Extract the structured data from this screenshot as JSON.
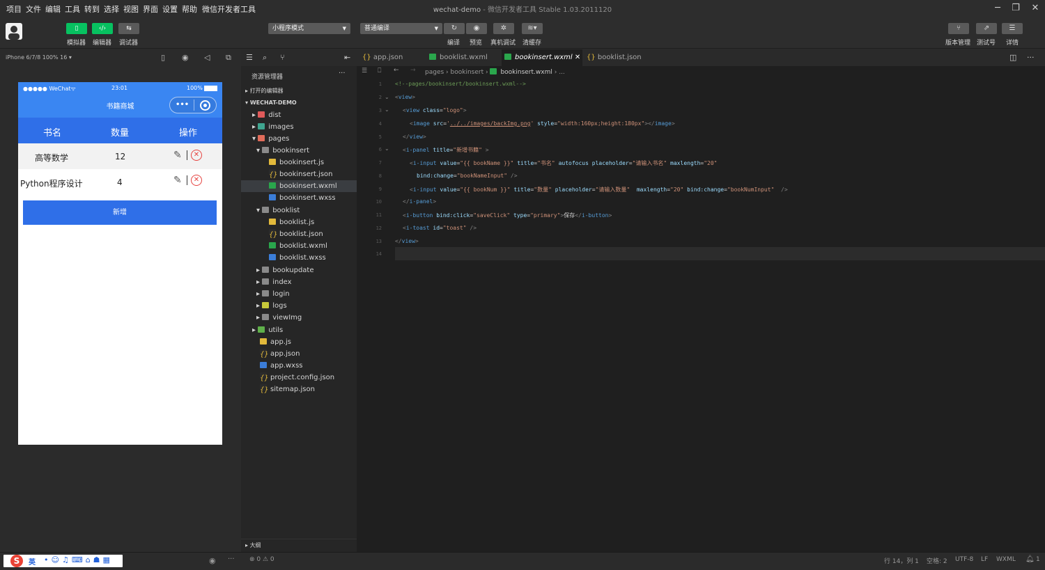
{
  "menu": {
    "items": [
      "项目",
      "文件",
      "编辑",
      "工具",
      "转到",
      "选择",
      "视图",
      "界面",
      "设置",
      "帮助",
      "微信开发者工具"
    ]
  },
  "window": {
    "title": "wechat-demo",
    "app_name": "微信开发者工具 Stable 1.03.2011120"
  },
  "toolbar": {
    "simulator_label": "模拟器",
    "editor_label": "编辑器",
    "debugger_label": "调试器",
    "mode_select": "小程序模式",
    "compile_select": "普通编译",
    "compile_label": "编译",
    "preview_label": "预览",
    "realdevice_label": "真机调试",
    "clearcache_label": "清缓存",
    "version_label": "版本管理",
    "testid_label": "测试号",
    "details_label": "详情",
    "accent": "#07c160"
  },
  "simulator": {
    "device": "iPhone 6/7/8 100% 16 ▾",
    "status_carrier": "●●●●● WeChat",
    "status_time": "23:01",
    "status_battery": "100%",
    "nav_title": "书籍商城",
    "table_headers": [
      "书名",
      "数量",
      "操作"
    ],
    "rows": [
      {
        "name": "高等数学",
        "count": "12"
      },
      {
        "name": "Python程序设计",
        "count": "4"
      }
    ],
    "add_button": "新增",
    "primary_color": "#2f6fe8"
  },
  "explorer": {
    "title": "资源管理器",
    "open_editors": "打开的编辑器",
    "project": "WECHAT-DEMO",
    "items": [
      "dist",
      "images",
      "pages",
      "bookinsert",
      "bookinsert.js",
      "bookinsert.json",
      "bookinsert.wxml",
      "bookinsert.wxss",
      "booklist",
      "booklist.js",
      "booklist.json",
      "booklist.wxml",
      "booklist.wxss",
      "bookupdate",
      "index",
      "login",
      "logs",
      "viewImg",
      "utils",
      "app.js",
      "app.json",
      "app.wxss",
      "project.config.json",
      "sitemap.json"
    ],
    "outline": "大纲"
  },
  "editor": {
    "tabs": [
      "app.json",
      "booklist.wxml",
      "bookinsert.wxml",
      "booklist.json"
    ],
    "breadcrumb": [
      "pages",
      "bookinsert",
      "bookinsert.wxml",
      "..."
    ],
    "line_numbers": [
      "1",
      "2",
      "3",
      "4",
      "5",
      "6",
      "7",
      "8",
      "9",
      "10",
      "11",
      "12",
      "13",
      "14"
    ]
  },
  "status": {
    "errors": "⊗ 0 ⚠ 0",
    "position": "行 14，列 1",
    "spaces": "空格: 2",
    "encoding": "UTF-8",
    "eol": "LF",
    "language": "WXML",
    "notifications": "1",
    "ime": "英"
  }
}
